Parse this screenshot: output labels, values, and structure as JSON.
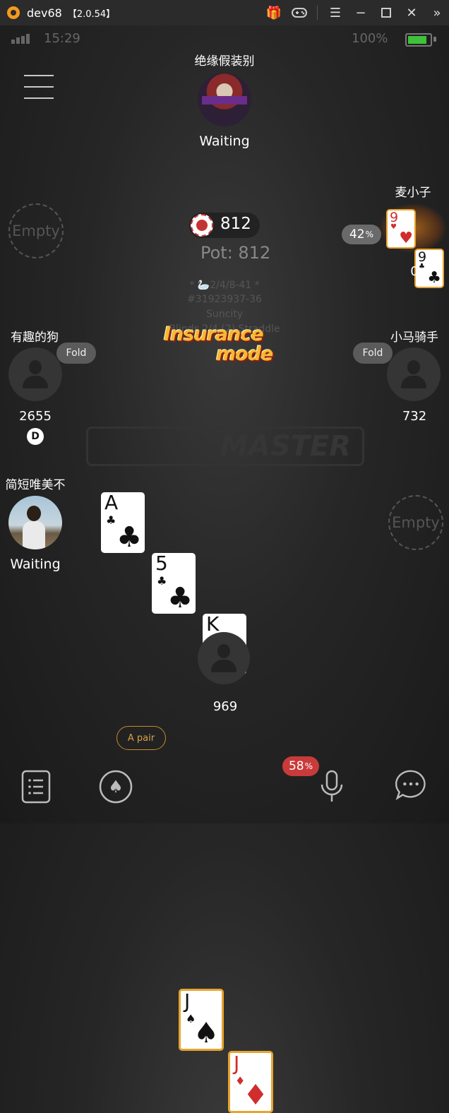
{
  "window": {
    "app_name": "dev68",
    "version": "【2.0.54】"
  },
  "titlebar_icons": [
    "gift-icon",
    "gamepad-icon",
    "menu-icon",
    "minimize-icon",
    "maximize-icon",
    "close-icon",
    "expand-icon"
  ],
  "status": {
    "time": "15:29",
    "battery": "100%",
    "battery_level": 1.0
  },
  "seats": {
    "top": {
      "name": "绝缘假装别",
      "status": "Waiting"
    },
    "right_top": {
      "name": "麦小子",
      "stack": "0",
      "equity": "42",
      "card1_rank": "9",
      "card1_suit": "♥",
      "card2_rank": "9",
      "card2_suit": "♣"
    },
    "left_top": {
      "label": "Empty"
    },
    "left_mid": {
      "name": "有趣的狗",
      "action": "Fold",
      "stack": "2655",
      "dealer": "D"
    },
    "right_mid": {
      "name": "小马骑手",
      "action": "Fold",
      "stack": "732"
    },
    "left_bottom": {
      "name": "简短唯美不",
      "status": "Waiting"
    },
    "right_bottom": {
      "label": "Empty"
    },
    "hero": {
      "stack": "969",
      "hand_label": "A pair",
      "equity": "58",
      "card1_rank": "J",
      "card1_suit": "♠",
      "card2_rank": "J",
      "card2_suit": "♦"
    }
  },
  "pot": {
    "amount": "812",
    "total": "Pot: 812"
  },
  "table_info": {
    "line1": "* 🦢2/4/8-41 *",
    "line2": "#31923937-36",
    "line3": "Suncity",
    "line4": "Blinds 2/4 (2) Straddle"
  },
  "banner": {
    "line1": "Insurance",
    "line2": "mode"
  },
  "watermark": "MASTER",
  "board": [
    {
      "rank": "A",
      "suit": "♣"
    },
    {
      "rank": "5",
      "suit": "♣"
    },
    {
      "rank": "K",
      "suit": "♣"
    }
  ],
  "percent_sign": "%",
  "bottom_icons": [
    "history-icon",
    "spade-icon",
    "mic-icon",
    "chat-icon"
  ],
  "colors": {
    "accent_gold": "#e7a42f",
    "equity_red": "#c93b3b",
    "equity_gray": "#6a6a6a"
  }
}
